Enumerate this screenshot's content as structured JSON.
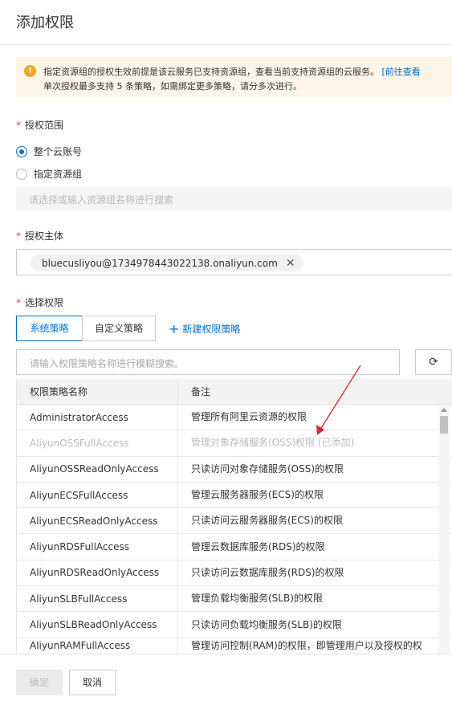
{
  "dialog": {
    "title": "添加权限"
  },
  "notice": {
    "line1": "指定资源组的授权生效前提是该云服务已支持资源组，查看当前支持资源组的云服务。",
    "link": "[前往查看",
    "line2": "单次授权最多支持 5 条策略，如需绑定更多策略，请分多次进行。"
  },
  "scope": {
    "label": "授权范围",
    "options": [
      "整个云账号",
      "指定资源组"
    ],
    "selected": "整个云账号",
    "resource_group_placeholder": "请选择或输入资源组名称进行搜索"
  },
  "principal": {
    "label": "授权主体",
    "tag": "bluecusliyou@1734978443022138.onaliyun.com"
  },
  "policies": {
    "label": "选择权限",
    "tabs": [
      "系统策略",
      "自定义策略"
    ],
    "active_tab": "系统策略",
    "new_policy": "新建权限策略",
    "search_placeholder": "请输入权限策略名称进行模糊搜索。",
    "columns": [
      "权限策略名称",
      "备注"
    ],
    "rows": [
      {
        "name": "AdministratorAccess",
        "note": "管理所有阿里云资源的权限",
        "disabled": false
      },
      {
        "name": "AliyunOSSFullAccess",
        "note": "管理对象存储服务(OSS)权限  (已添加)",
        "disabled": true
      },
      {
        "name": "AliyunOSSReadOnlyAccess",
        "note": "只读访问对象存储服务(OSS)的权限",
        "disabled": false
      },
      {
        "name": "AliyunECSFullAccess",
        "note": "管理云服务器服务(ECS)的权限",
        "disabled": false
      },
      {
        "name": "AliyunECSReadOnlyAccess",
        "note": "只读访问云服务器服务(ECS)的权限",
        "disabled": false
      },
      {
        "name": "AliyunRDSFullAccess",
        "note": "管理云数据库服务(RDS)的权限",
        "disabled": false
      },
      {
        "name": "AliyunRDSReadOnlyAccess",
        "note": "只读访问云数据库服务(RDS)的权限",
        "disabled": false
      },
      {
        "name": "AliyunSLBFullAccess",
        "note": "管理负载均衡服务(SLB)的权限",
        "disabled": false
      },
      {
        "name": "AliyunSLBReadOnlyAccess",
        "note": "只读访问负载均衡服务(SLB)的权限",
        "disabled": false
      },
      {
        "name": "AliyunRAMFullAccess",
        "note": "管理访问控制(RAM)的权限，即管理用户以及授权的权",
        "disabled": false
      }
    ]
  },
  "footer": {
    "confirm": "确定",
    "cancel": "取消"
  },
  "colors": {
    "accent": "#0070cc",
    "warning": "#f5a623",
    "required": "#e44",
    "annotation_arrow": "#e0242b"
  }
}
